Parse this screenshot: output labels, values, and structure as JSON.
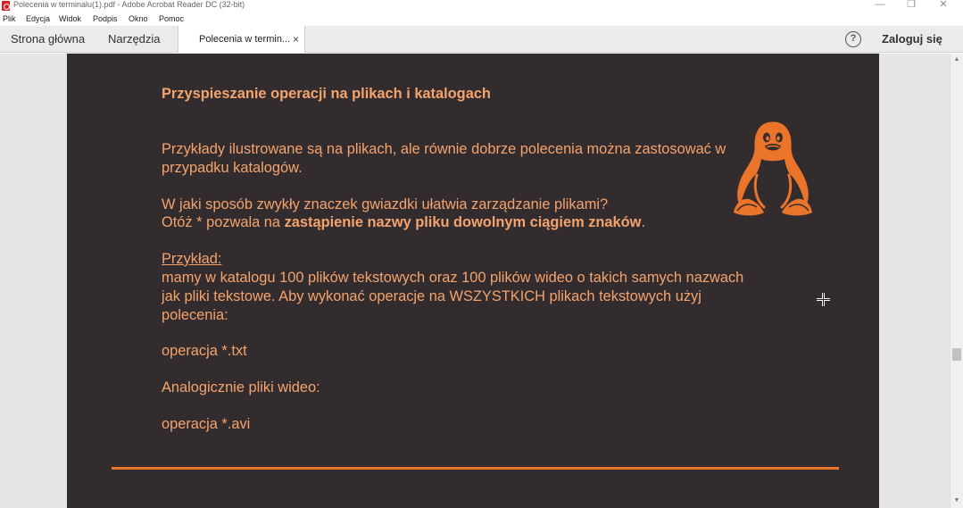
{
  "window": {
    "title": "Polecenia w terminalu(1).pdf - Adobe Acrobat Reader DC (32-bit)",
    "minimize": "—",
    "restore": "❐",
    "close": "✕"
  },
  "menu": [
    "Plik",
    "Edycja",
    "Widok",
    "Podpis",
    "Okno",
    "Pomoc"
  ],
  "tabs": {
    "home": "Strona główna",
    "tools": "Narzędzia",
    "document": "Polecenia w termin...",
    "document_close": "×",
    "help": "?",
    "login": "Zaloguj się"
  },
  "document": {
    "heading": "Przyspieszanie operacji na plikach i katalogach",
    "para1_line1": "Przykłady ilustrowane są na plikach, ale równie dobrze polecenia można zastosować w",
    "para1_line2": "przypadku katalogów.",
    "question": "W jaki sposób zwykły znaczek gwiazdki ułatwia zarządzanie plikami?",
    "answer_prefix": "Otóż * pozwala na ",
    "answer_bold": "zastąpienie nazwy pliku dowolnym ciągiem znaków",
    "answer_suffix": ".",
    "example_label": "Przykład:",
    "example_line1": "mamy w katalogu 100 plików tekstowych oraz 100 plików wideo o takich samych nazwach",
    "example_line2": "jak pliki tekstowe. Aby wykonać operacje na WSZYSTKICH plikach tekstowych użyj",
    "example_line3": "polecenia:",
    "command_txt": "operacja *.txt",
    "video_intro": "Analogicznie pliki wideo:",
    "command_avi": "operacja *.avi"
  },
  "colors": {
    "page_background": "#332c2f",
    "text": "#f3a36c",
    "rule": "#e9742a",
    "tux": "#e9742a"
  },
  "icons": [
    "acrobat-icon",
    "help-icon",
    "tux-penguin-icon",
    "crosshair-cursor-icon"
  ]
}
